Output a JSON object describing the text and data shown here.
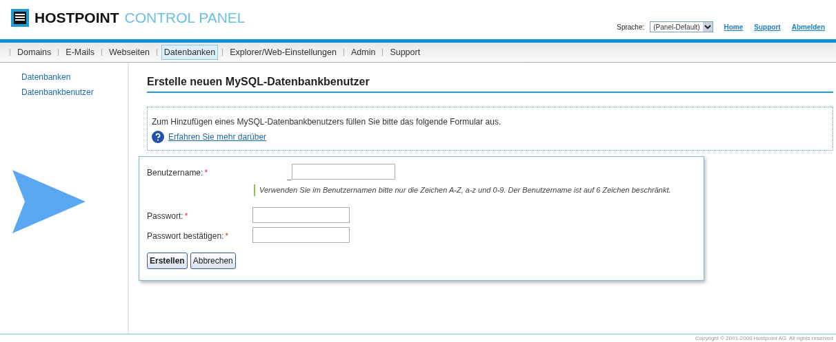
{
  "header": {
    "brand": "HOSTPOINT",
    "product": "CONTROL PANEL",
    "language_label": "Sprache:",
    "language_value": "(Panel-Default)",
    "links": [
      "Home",
      "Support",
      "Abmelden"
    ]
  },
  "nav": [
    {
      "label": "Domains",
      "selected": false
    },
    {
      "label": "E-Mails",
      "selected": false
    },
    {
      "label": "Webseiten",
      "selected": false
    },
    {
      "label": "Datenbanken",
      "selected": true
    },
    {
      "label": "Explorer/Web-Einstellungen",
      "selected": false
    },
    {
      "label": "Admin",
      "selected": false
    },
    {
      "label": "Support",
      "selected": false
    }
  ],
  "sidebar": {
    "items": [
      "Datenbanken",
      "Datenbankbenutzer"
    ]
  },
  "page_title": "Erstelle neuen MySQL-Datenbankbenutzer",
  "info": {
    "text": "Zum Hinzufügen eines MySQL-Datenbankbenutzers füllen Sie bitte das folgende Formular aus.",
    "link": "Erfahren Sie mehr darüber"
  },
  "form": {
    "fields": [
      {
        "label": "Benutzername:",
        "required_mark": "*",
        "prefix": "_",
        "hint": "Verwenden Sie im Benutzernamen bitte nur die Zeichen A-Z, a-z und 0-9. Der Benutzername ist auf 6 Zeichen beschränkt."
      },
      {
        "label": "Passwort:",
        "required_mark": "*"
      },
      {
        "label": "Passwort bestätigen:",
        "required_mark": "*"
      }
    ],
    "buttons": [
      {
        "label": "Erstellen",
        "kind": "primary"
      },
      {
        "label": "Abbrechen",
        "kind": "secondary"
      }
    ]
  },
  "footer": "Copyright © 2001-2009 Hostpoint AG. All rights reserved"
}
